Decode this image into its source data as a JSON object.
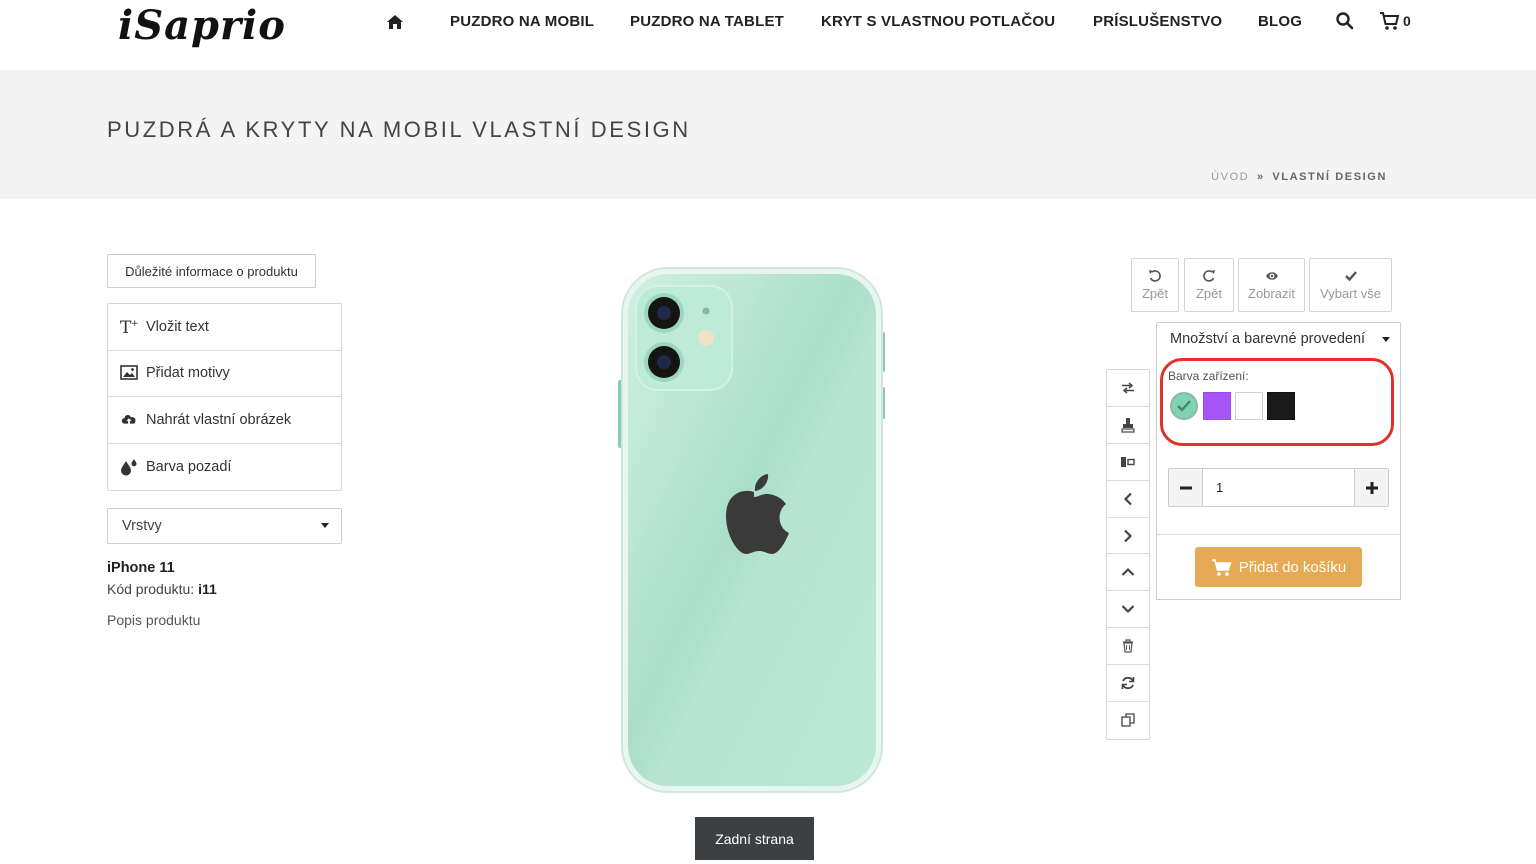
{
  "header": {
    "logo": "iSaprio",
    "nav": [
      {
        "label": "PUZDRO NA MOBIL"
      },
      {
        "label": "PUZDRO NA TABLET"
      },
      {
        "label": "KRYT S VLASTNOU POTLAČOU"
      },
      {
        "label": "PRÍSLUŠENSTVO"
      },
      {
        "label": "BLOG"
      }
    ],
    "cart_count": "0"
  },
  "band": {
    "title": "PUZDRÁ A KRYTY NA MOBIL VLASTNÍ DESIGN",
    "breadcrumb": {
      "home": "ÚVOD",
      "separator": "»",
      "current": "VLASTNÍ DESIGN"
    }
  },
  "left": {
    "info_button": "Důležité informace o produktu",
    "tools": [
      {
        "label": "Vložit text",
        "icon": "text-add-icon"
      },
      {
        "label": "Přidat motivy",
        "icon": "image-icon"
      },
      {
        "label": "Nahrát vlastní obrázek",
        "icon": "cloud-upload-icon"
      },
      {
        "label": "Barva pozadí",
        "icon": "color-drops-icon"
      }
    ],
    "layers_select": "Vrstvy",
    "product_name": "iPhone 11",
    "product_code_label": "Kód produktu:",
    "product_code": "i11",
    "product_description": "Popis produktu"
  },
  "canvas": {
    "side_button": "Zadní strana"
  },
  "actions": [
    {
      "label": "Zpět",
      "icon": "undo-icon"
    },
    {
      "label": "Zpět",
      "icon": "redo-icon"
    },
    {
      "label": "Zobrazit",
      "icon": "eye-icon"
    },
    {
      "label": "Vybart vše",
      "icon": "check-icon"
    }
  ],
  "vertical_tools": [
    "swap-icon",
    "stamp-icon",
    "align-icon",
    "chevron-left-icon",
    "chevron-right-icon",
    "chevron-up-icon",
    "chevron-down-icon",
    "trash-icon",
    "refresh-icon",
    "copy-icon"
  ],
  "options": {
    "header": "Množství a barevné provedení",
    "color_label": "Barva zařízení:",
    "colors": [
      "#7fd3b1",
      "#a855f7",
      "#ffffff",
      "#1a1a1a"
    ],
    "selected_color": "#7fd3b1",
    "quantity": "1",
    "add_to_cart": "Přidat do košíku"
  },
  "colors": {
    "accent_button": "#e6a954",
    "highlight": "#e0322b",
    "dark_button": "#3c4043"
  }
}
